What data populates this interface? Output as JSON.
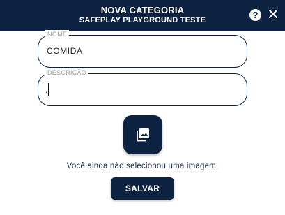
{
  "header": {
    "title": "NOVA CATEGORIA",
    "subtitle": "SAFEPLAY PLAYGROUND TESTE",
    "help_icon": "help-icon",
    "help_glyph": "?",
    "close_icon": "close-icon"
  },
  "form": {
    "name_field": {
      "label": "NOME",
      "value": "COMIDA"
    },
    "description_field": {
      "label": "DESCRIÇÃO",
      "value": "."
    },
    "image_button_icon": "image-gallery-icon",
    "no_image_text": "Você ainda não selecionou uma imagem.",
    "save_label": "SALVAR"
  },
  "colors": {
    "primary": "#0d2240",
    "label_gray": "#9a9a9a",
    "background": "#ffffff"
  }
}
